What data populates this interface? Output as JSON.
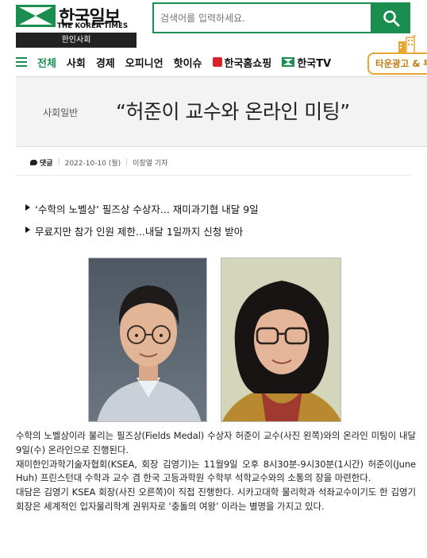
{
  "header": {
    "logo_title": "한국일보",
    "logo_subtitle": "THE KOREA TIMES",
    "logo_band": "한인사회",
    "search_placeholder": "검색어를 입력하세요."
  },
  "nav": {
    "items": [
      {
        "label": "전체",
        "active": true
      },
      {
        "label": "사회"
      },
      {
        "label": "경제"
      },
      {
        "label": "오피니언"
      },
      {
        "label": "핫이슈"
      },
      {
        "label": "한국홈쇼핑"
      },
      {
        "label": "한국TV"
      }
    ],
    "town_ad_label": "타운광고 & 부"
  },
  "article": {
    "category": "사회일반",
    "headline": "“허준이 교수와 온라인 미팅”",
    "comment_label": "댓글",
    "date": "2022-10-10 (월)",
    "author": "이창열 기자"
  },
  "related": [
    "‘수학의 노벨상’ 필즈상 수상자... 재미과기협 내달 9일",
    "무료지만 참가 인원 제한...내달 1일까지 신청 받아"
  ],
  "body": [
    "수학의 노벨상이라 불리는 필즈상(Fields Medal) 수상자 허준이 교수(사진 왼쪽)와의 온라인 미팅이 내달 9일(수) 온라인으로 진행된다.",
    "재미한인과학기술자협회(KSEA, 회장 김영기)는 11월9일 오후 8시30분-9시30분(1시간) 허준이(June Huh) 프린스턴대 수학과 교수 겸 한국 고등과학원 수학부 석학교수와의 소통의 장을 마련한다.",
    "대담은 김영기 KSEA 회장(사진 오른쪽)이 직접 진행한다. 시카고대학 물리학과 석좌교수이기도 한 김영기 회장은 세계적인 입자물리학계 권위자로 ‘충돌의 여왕’ 이라는 별명을 가지고 있다."
  ],
  "colors": {
    "brand_green": "#1a8e4e",
    "ad_orange": "#e8a531",
    "shop_red": "#d8232a"
  }
}
